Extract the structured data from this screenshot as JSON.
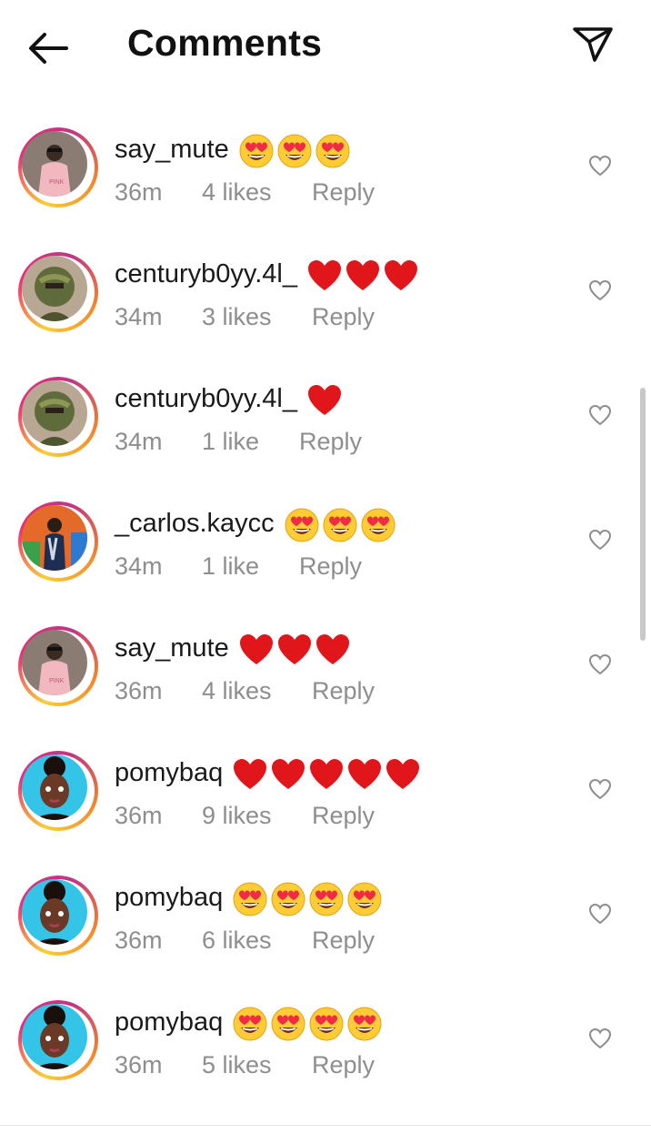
{
  "header": {
    "title": "Comments",
    "back_icon": "arrow-left-icon",
    "send_icon": "paper-plane-icon"
  },
  "colors": {
    "ring_start": "#f9ce34",
    "ring_mid": "#ee2a7b",
    "ring_end": "#c13584",
    "heart_red": "#e0161b",
    "meta_gray": "#8e8e8e"
  },
  "comments": [
    {
      "username": "say_mute",
      "emoji": "heart-eyes",
      "emoji_count": 3,
      "time": "36m",
      "likes": "4 likes",
      "reply": "Reply",
      "avatar": "person-pink-shirt"
    },
    {
      "username": "centuryb0yy.4l_",
      "emoji": "red-heart",
      "emoji_count": 3,
      "time": "34m",
      "likes": "3 likes",
      "reply": "Reply",
      "avatar": "person-camo-mask"
    },
    {
      "username": "centuryb0yy.4l_",
      "emoji": "red-heart",
      "emoji_count": 1,
      "time": "34m",
      "likes": "1 like",
      "reply": "Reply",
      "avatar": "person-camo-mask"
    },
    {
      "username": "_carlos.kaycc",
      "emoji": "heart-eyes",
      "emoji_count": 3,
      "time": "34m",
      "likes": "1 like",
      "reply": "Reply",
      "avatar": "person-graffiti"
    },
    {
      "username": "say_mute",
      "emoji": "red-heart",
      "emoji_count": 3,
      "time": "36m",
      "likes": "4 likes",
      "reply": "Reply",
      "avatar": "person-pink-shirt"
    },
    {
      "username": "pomybaq",
      "emoji": "red-heart",
      "emoji_count": 5,
      "time": "36m",
      "likes": "9 likes",
      "reply": "Reply",
      "avatar": "cartoon-girl"
    },
    {
      "username": "pomybaq",
      "emoji": "heart-eyes",
      "emoji_count": 4,
      "time": "36m",
      "likes": "6 likes",
      "reply": "Reply",
      "avatar": "cartoon-girl"
    },
    {
      "username": "pomybaq",
      "emoji": "heart-eyes",
      "emoji_count": 4,
      "time": "36m",
      "likes": "5 likes",
      "reply": "Reply",
      "avatar": "cartoon-girl"
    }
  ]
}
